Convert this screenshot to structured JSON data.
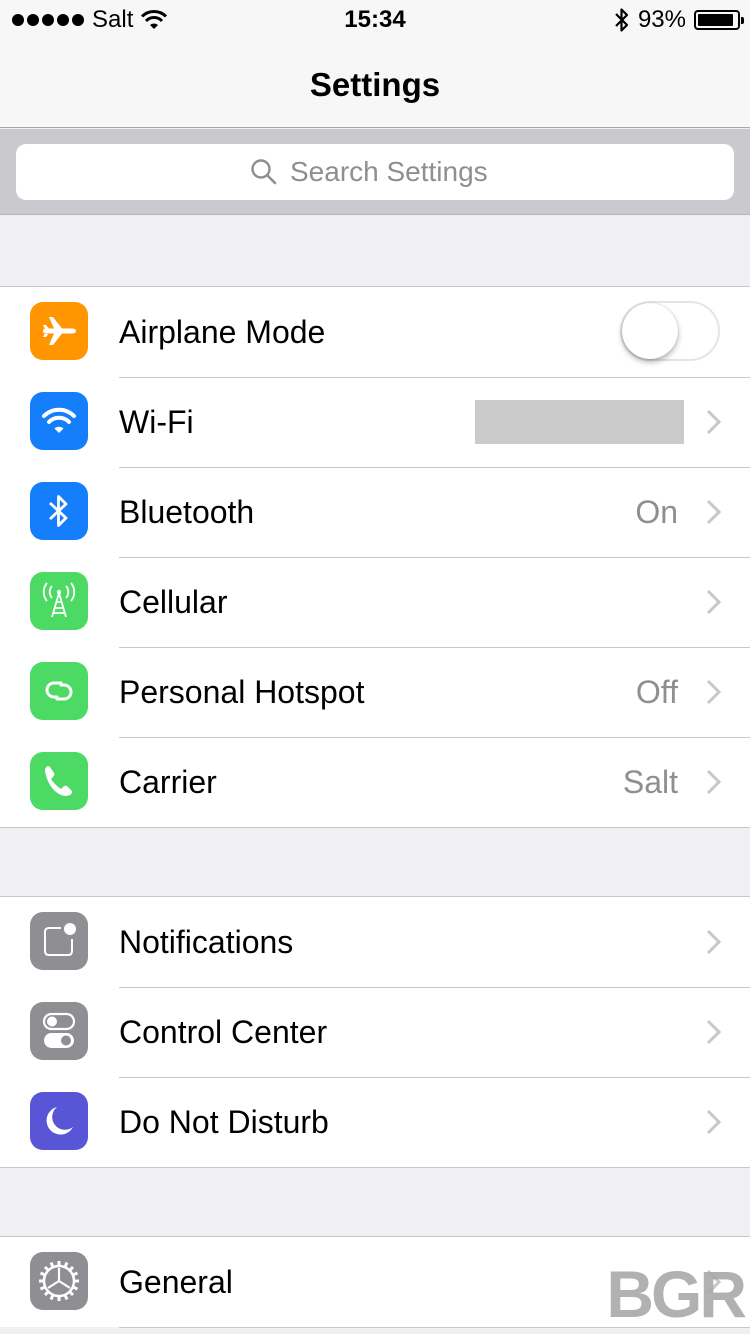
{
  "status_bar": {
    "signal_dots": 5,
    "carrier": "Salt",
    "time": "15:34",
    "battery_percent": "93%",
    "battery_level": 0.93
  },
  "nav": {
    "title": "Settings"
  },
  "search": {
    "placeholder": "Search Settings"
  },
  "groups": [
    {
      "items": [
        {
          "label": "Airplane Mode",
          "icon": "airplane-icon",
          "color": "#ff9500",
          "control": "toggle",
          "toggle_on": false
        },
        {
          "label": "Wi-Fi",
          "icon": "wifi-icon",
          "color": "#147efb",
          "value": "",
          "value_redacted": true
        },
        {
          "label": "Bluetooth",
          "icon": "bluetooth-icon",
          "color": "#147efb",
          "value": "On"
        },
        {
          "label": "Cellular",
          "icon": "cell-tower-icon",
          "color": "#4cd964",
          "value": ""
        },
        {
          "label": "Personal Hotspot",
          "icon": "hotspot-link-icon",
          "color": "#4cd964",
          "value": "Off"
        },
        {
          "label": "Carrier",
          "icon": "phone-icon",
          "color": "#4cd964",
          "value": "Salt"
        }
      ]
    },
    {
      "items": [
        {
          "label": "Notifications",
          "icon": "notifications-icon",
          "color": "#8e8e93",
          "value": ""
        },
        {
          "label": "Control Center",
          "icon": "control-center-icon",
          "color": "#8e8e93",
          "value": ""
        },
        {
          "label": "Do Not Disturb",
          "icon": "moon-icon",
          "color": "#5856d6",
          "value": ""
        }
      ]
    },
    {
      "items": [
        {
          "label": "General",
          "icon": "gear-icon",
          "color": "#8e8e93",
          "value": ""
        }
      ]
    }
  ],
  "watermark": "BGR"
}
